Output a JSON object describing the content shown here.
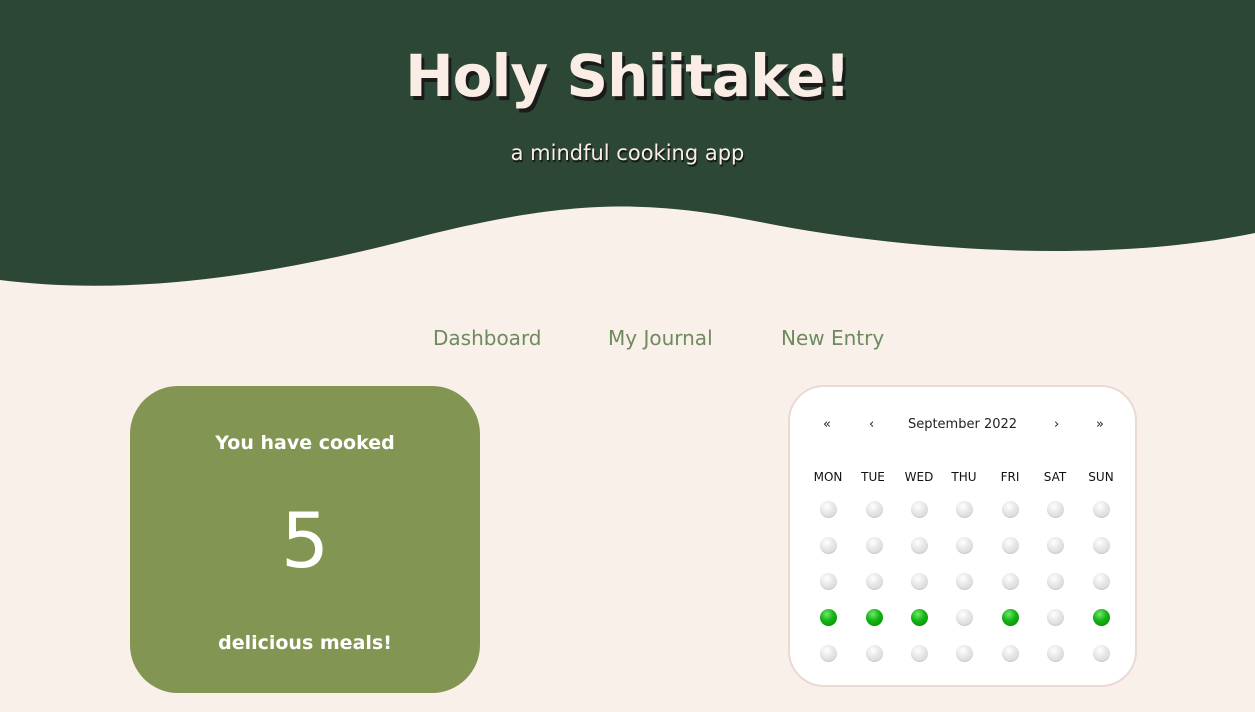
{
  "header": {
    "title": "Holy Shiitake!",
    "subtitle": "a mindful cooking app",
    "background_color": "#2c4735"
  },
  "nav": {
    "items": [
      {
        "label": "Dashboard"
      },
      {
        "label": "My Journal"
      },
      {
        "label": "New Entry"
      }
    ],
    "color": "#6e8a5e"
  },
  "stats": {
    "label_top": "You have cooked",
    "count": "5",
    "label_bottom": "delicious meals!",
    "card_color": "#839552"
  },
  "calendar": {
    "prev_year_label": "«",
    "prev_month_label": "‹",
    "month_label": "September 2022",
    "next_month_label": "›",
    "next_year_label": "»",
    "weekdays": [
      "MON",
      "TUE",
      "WED",
      "THU",
      "FRI",
      "SAT",
      "SUN"
    ],
    "rows": [
      [
        0,
        0,
        0,
        0,
        0,
        0,
        0
      ],
      [
        0,
        0,
        0,
        0,
        0,
        0,
        0
      ],
      [
        0,
        0,
        0,
        0,
        0,
        0,
        0
      ],
      [
        1,
        1,
        1,
        0,
        1,
        0,
        1
      ],
      [
        0,
        0,
        0,
        0,
        0,
        0,
        0
      ]
    ],
    "cooked_color": "#12b312",
    "empty_color": "#dcdcdc"
  }
}
